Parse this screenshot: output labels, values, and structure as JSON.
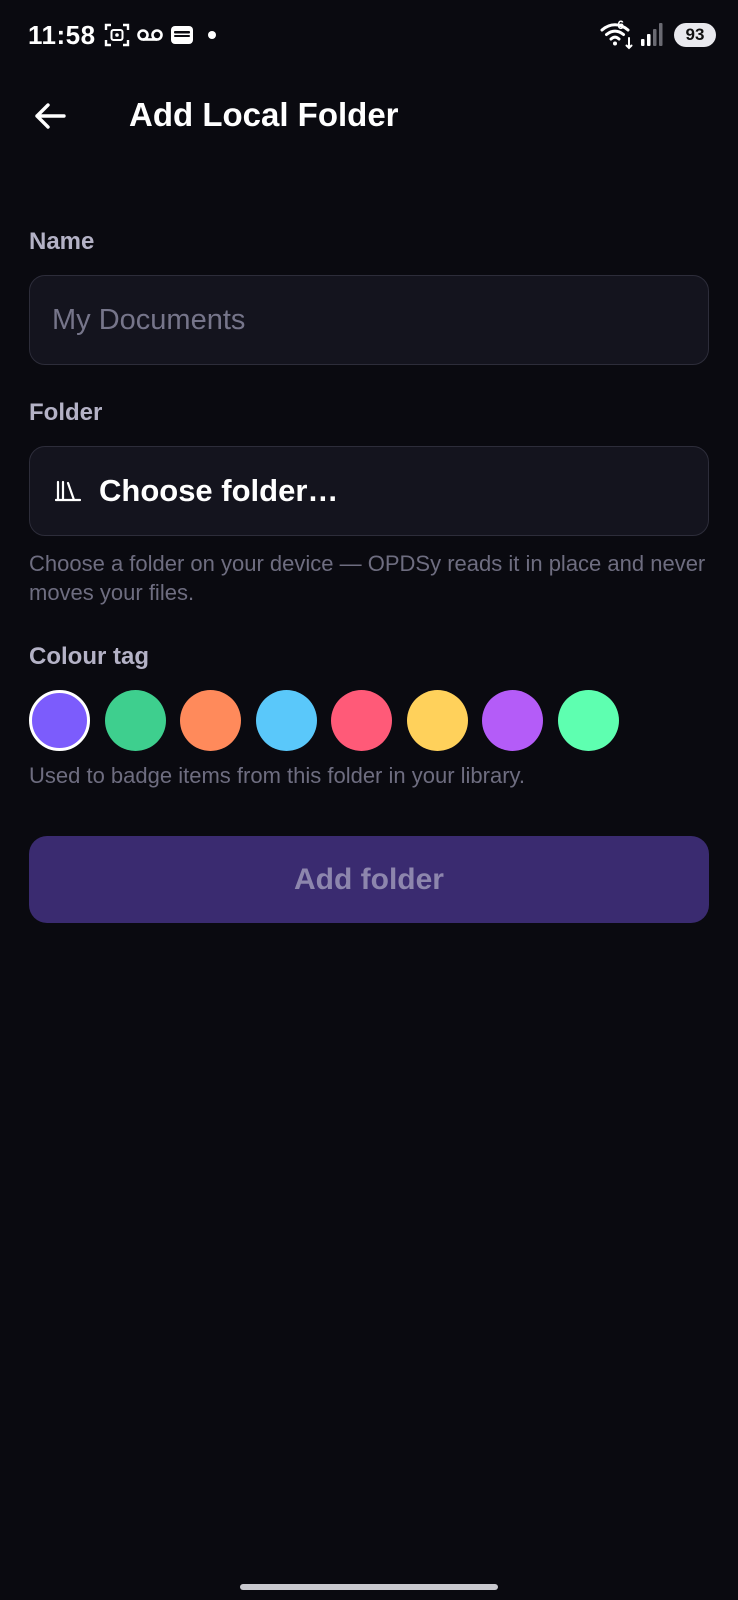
{
  "status_bar": {
    "time": "11:58",
    "battery": "93",
    "wifi_badge": "6",
    "left_icons": [
      "screenshot-icon",
      "voicemail-icon",
      "wallet-icon"
    ],
    "right_icons": [
      "wifi-icon",
      "signal-icon",
      "battery-icon"
    ]
  },
  "app_bar": {
    "back_icon": "arrow-left-icon",
    "title": "Add Local Folder"
  },
  "form": {
    "name_label": "Name",
    "name_value": "",
    "name_placeholder": "My Documents",
    "folder_label": "Folder",
    "folder_icon": "folder-library-icon",
    "folder_button_label": "Choose folder…",
    "folder_helper": "Choose a folder on your device — OPDSy reads it in place and never moves your files.",
    "colour_label": "Colour tag",
    "colours": [
      {
        "hex": "#7c5cfc",
        "selected": true
      },
      {
        "hex": "#3ecf8e",
        "selected": false
      },
      {
        "hex": "#ff8a5b",
        "selected": false
      },
      {
        "hex": "#5ac8fa",
        "selected": false
      },
      {
        "hex": "#ff5a78",
        "selected": false
      },
      {
        "hex": "#ffd15b",
        "selected": false
      },
      {
        "hex": "#b45cf8",
        "selected": false
      },
      {
        "hex": "#5effb0",
        "selected": false
      }
    ],
    "colour_helper": "Used to badge items from this folder in your library.",
    "submit_label": "Add folder"
  },
  "colors": {
    "background": "#0a0a10",
    "input_background": "#14141e",
    "button_disabled": "#3a2b70",
    "button_text_disabled": "#8d86ad",
    "label": "#b4b2c6",
    "helper": "#6e6d80"
  }
}
